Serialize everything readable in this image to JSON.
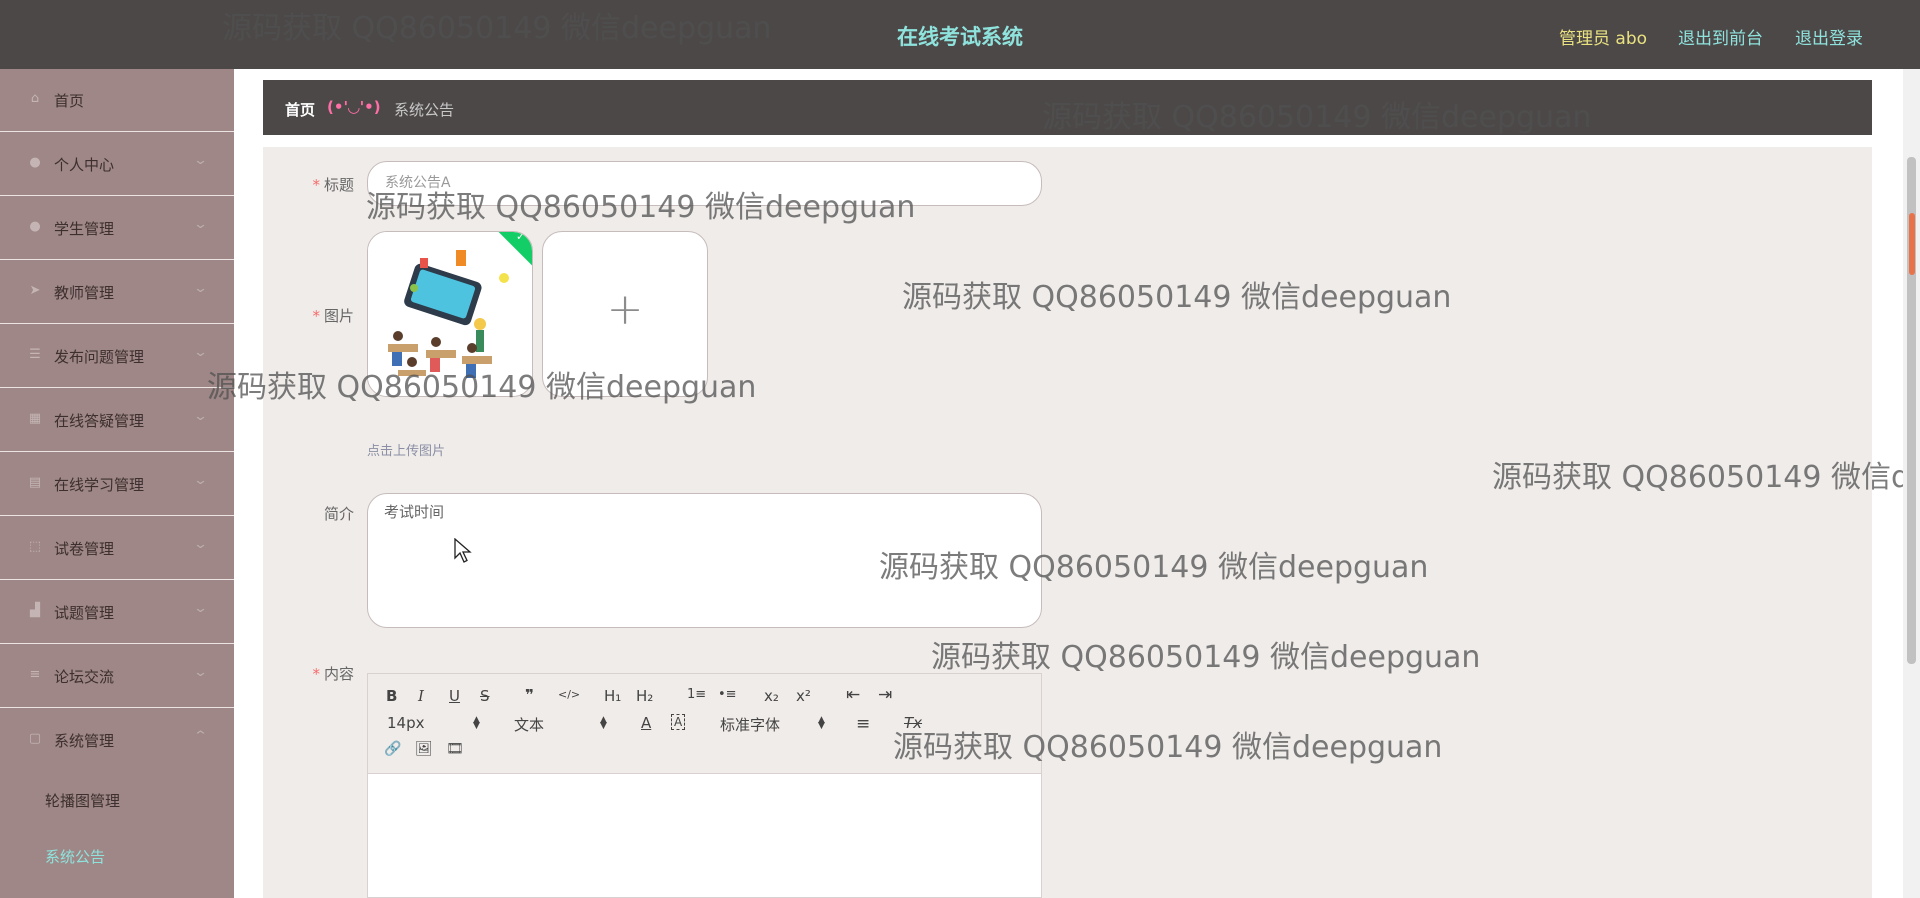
{
  "header": {
    "title": "在线考试系统",
    "user": "管理员 abo",
    "to_front": "退出到前台",
    "logout": "退出登录"
  },
  "sidebar": {
    "items": [
      {
        "label": "首页",
        "icon": "home-icon"
      },
      {
        "label": "个人中心",
        "icon": "user-icon"
      },
      {
        "label": "学生管理",
        "icon": "user-icon"
      },
      {
        "label": "教师管理",
        "icon": "send-icon"
      },
      {
        "label": "发布问题管理",
        "icon": "list-icon"
      },
      {
        "label": "在线答疑管理",
        "icon": "grid-icon"
      },
      {
        "label": "在线学习管理",
        "icon": "clipboard-icon"
      },
      {
        "label": "试卷管理",
        "icon": "frame-icon"
      },
      {
        "label": "试题管理",
        "icon": "chart-icon"
      },
      {
        "label": "论坛交流",
        "icon": "menu-icon"
      },
      {
        "label": "系统管理",
        "icon": "settings-icon"
      }
    ],
    "sub_items": [
      "轮播图管理",
      "系统公告"
    ]
  },
  "breadcrumb": {
    "home": "首页",
    "separator": "(•'◡'•)",
    "current": "系统公告"
  },
  "form": {
    "title_label": "标题",
    "title_value": "系统公告A",
    "image_label": "图片",
    "upload_tip": "点击上传图片",
    "upload_plus": "+",
    "intro_label": "简介",
    "intro_value": "考试时间",
    "content_label": "内容",
    "required_mark": "*"
  },
  "editor": {
    "bold": "B",
    "italic": "I",
    "underline": "U",
    "strike": "S",
    "quote": "❞",
    "code": "</>",
    "h1": "H₁",
    "h2": "H₂",
    "ordered_list": "1≡",
    "bullet_list": "•≡",
    "subscript": "x₂",
    "superscript": "x²",
    "outdent": "⇤",
    "indent": "⇥",
    "font_size": "14px",
    "header_select": "文本",
    "font_color": "A",
    "bg_color": "A",
    "font_family": "标准字体",
    "align": "≡",
    "clean": "Tx",
    "link": "🔗",
    "image": "🖼",
    "video": "🎞"
  },
  "watermark": "源码获取 QQ86050149 微信deepguan",
  "colors": {
    "topbar": "#4d4848",
    "accent_teal": "#8fe3dd",
    "user_yellow": "#e8e280",
    "sidebar": "#9e8786",
    "panel": "#f0ecea",
    "required": "#f56c6c"
  }
}
